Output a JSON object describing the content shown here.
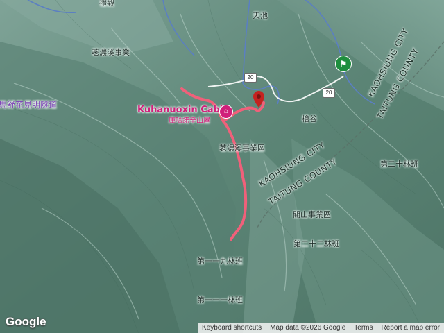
{
  "map": {
    "labels": {
      "lidu": "禮觀",
      "tianchi": "天池",
      "laonong_forest": "荖濃溪事業",
      "tunnel": "馬舒花見明隧道",
      "cabin_en": "Kuhanuoxin Cabin",
      "cabin_zh": "庫哈諾辛山屋",
      "laonong_area": "荖濃溪事業區",
      "meishan": "檜谷",
      "lot_20": "第二十林班",
      "guanshan_area": "關山事業區",
      "lot_22": "第二十二林班",
      "lot_119": "第一一九林班",
      "lot_111": "第一一一林班"
    },
    "county_labels": {
      "kaohsiung_city_1": "KAOHSIUNG CITY",
      "taitung_county_1": "TAITUNG COUNTY",
      "kaohsiung_city_2": "KAOHSIUNG CITY",
      "taitung_county_2": "TAITUNG COUNTY"
    },
    "road_shields": {
      "shield_1": "20",
      "shield_2": "20"
    },
    "icons": {
      "cabin": "lodging-icon",
      "pin": "map-pin-icon",
      "trailhead": "hiking-icon"
    },
    "colors": {
      "route": "#f0607a",
      "river": "#5b7fc2",
      "terrain": "#5f8a7c",
      "cabin_label": "#d0207a",
      "tunnel_label": "#7b3fb5"
    }
  },
  "footer": {
    "logo": "Google",
    "keyboard": "Keyboard shortcuts",
    "mapdata": "Map data ©2026 Google",
    "terms": "Terms",
    "report": "Report a map error"
  }
}
